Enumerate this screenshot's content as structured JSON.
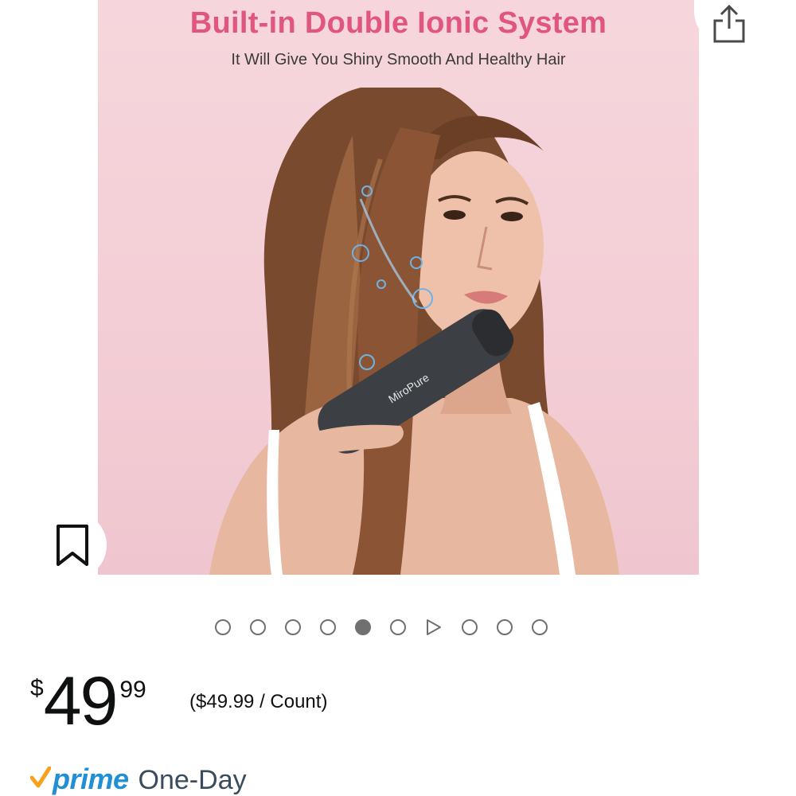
{
  "product_image": {
    "headline": "Built-in Double Ionic System",
    "subhead": "It Will Give You Shiny Smooth And Healthy Hair",
    "brand_on_device": "MiroPure"
  },
  "gallery": {
    "total": 10,
    "active_index": 4,
    "video_index": 6
  },
  "icons": {
    "share": "share-icon",
    "save": "bookmark-icon",
    "video": "play-icon",
    "prime_check": "check-icon"
  },
  "price": {
    "symbol": "$",
    "whole": "49",
    "fraction": "99",
    "unit_price": "($49.99 / Count)"
  },
  "prime": {
    "label": "prime",
    "delivery": "One-Day"
  },
  "colors": {
    "headline": "#e0567f",
    "prime_blue": "#1f8fd6",
    "prime_check": "#f7a21b",
    "image_bg": "#f3cdd5"
  }
}
